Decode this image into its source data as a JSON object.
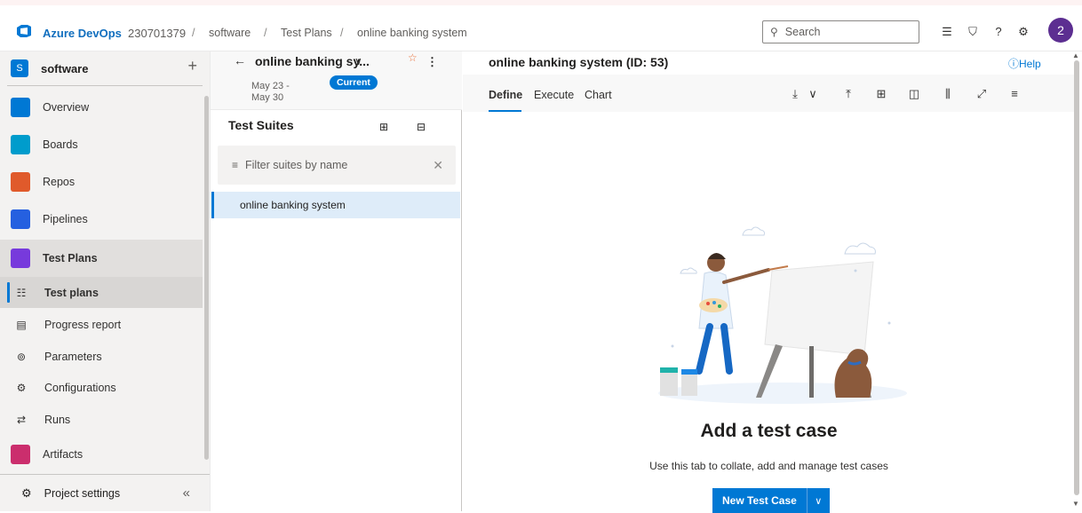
{
  "topbar": {
    "brand": "Azure DevOps",
    "org": "230701379",
    "breadcrumb": [
      "software",
      "Test Plans",
      "online banking system"
    ],
    "separator": "/",
    "search_placeholder": "Search",
    "avatar_initial": "2"
  },
  "sidebar": {
    "project_badge": "S",
    "project_name": "software",
    "items": [
      {
        "label": "Overview",
        "icon": "overview-icon",
        "color": "#0078d4"
      },
      {
        "label": "Boards",
        "icon": "boards-icon",
        "color": "#009ccc"
      },
      {
        "label": "Repos",
        "icon": "repos-icon",
        "color": "#e05a2b"
      },
      {
        "label": "Pipelines",
        "icon": "pipelines-icon",
        "color": "#2560e0"
      },
      {
        "label": "Test Plans",
        "icon": "test-plans-icon",
        "color": "#773adc"
      }
    ],
    "sub_items": [
      {
        "label": "Test plans",
        "icon": "test-plans-list-icon",
        "glyph": "☷"
      },
      {
        "label": "Progress report",
        "icon": "progress-report-icon",
        "glyph": "▤"
      },
      {
        "label": "Parameters",
        "icon": "parameters-icon",
        "glyph": "⊚"
      },
      {
        "label": "Configurations",
        "icon": "configurations-icon",
        "glyph": "⚙"
      },
      {
        "label": "Runs",
        "icon": "runs-icon",
        "glyph": "⇄"
      }
    ],
    "artifacts": {
      "label": "Artifacts",
      "color": "#cb2e6d"
    },
    "project_settings": "Project settings",
    "collapse_glyph": "«"
  },
  "plan": {
    "name": "online banking sy...",
    "dates": "May 23 - May 30",
    "status": "Current",
    "suites_title": "Test Suites",
    "filter_placeholder": "Filter suites by name",
    "suites": [
      "online banking system"
    ]
  },
  "main": {
    "title": "online banking system (ID: 53)",
    "help": "ⓘHelp",
    "tabs": [
      "Define",
      "Execute",
      "Chart"
    ],
    "active_tab": "Define",
    "empty_title": "Add a test case",
    "empty_desc": "Use this tab to collate, add and manage test cases",
    "new_button": "New Test Case"
  },
  "colors": {
    "accent": "#0078d4",
    "avatar": "#5c2e91"
  }
}
